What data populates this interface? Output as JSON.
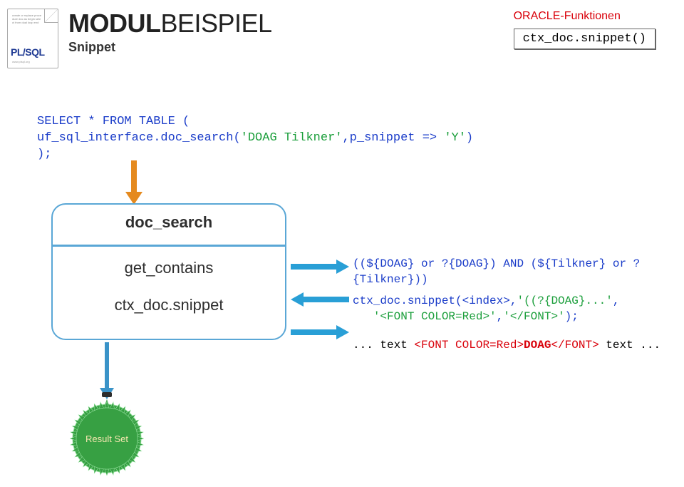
{
  "header": {
    "title_bold": "MODUL",
    "title_light": "BEISPIEL",
    "subtitle": "Snippet",
    "plsql_label": "PL/SQL",
    "oracle_funcs": "ORACLE-Funktionen",
    "ctx_box": "ctx_doc.snippet()"
  },
  "code": {
    "line1_kw": "SELECT * FROM TABLE (",
    "line2_indent": "   uf_sql_interface.doc_search(",
    "line2_str": "'DOAG Tilkner'",
    "line2_mid": ",p_snippet => ",
    "line2_str2": "'Y'",
    "line2_end": ")",
    "line3": ");"
  },
  "diagram": {
    "title": "doc_search",
    "row1": "get_contains",
    "row2": "ctx_doc.snippet"
  },
  "outputs": {
    "getcontains": "((${DOAG} or ?{DOAG}) AND (${Tilkner} or ?{Tilkner}))",
    "snippet_pre": "ctx_doc.snippet(<index>,",
    "snippet_str1": "'((?{DOAG}...'",
    "snippet_mid": ",",
    "snippet_str2": "'<FONT COLOR=Red>'",
    "snippet_mid2": ",",
    "snippet_str3": "'</FONT>'",
    "snippet_end": ");",
    "result_pre": "... text ",
    "result_open": "<FONT COLOR=Red>",
    "result_doag": "DOAG",
    "result_close": "</FONT>",
    "result_post": " text ..."
  },
  "result_set": "Result Set"
}
